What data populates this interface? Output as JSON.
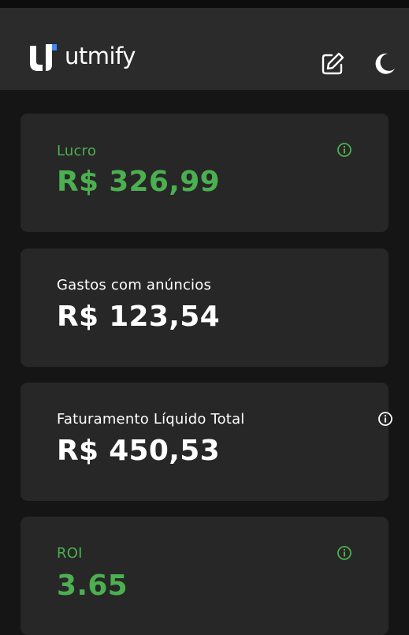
{
  "app": {
    "brand_name": "utmify",
    "colors": {
      "accent_green": "#4caf50",
      "header_bg": "#2b2b2b",
      "card_bg": "#272727",
      "page_bg": "#151515"
    },
    "icons": [
      "logo-mark-icon",
      "edit-icon",
      "moon-icon",
      "info-icon"
    ]
  },
  "cards": [
    {
      "label": "Lucro",
      "value": "R$ 326,99",
      "accent": "green"
    },
    {
      "label": "Gastos com anúncios",
      "value": "R$ 123,54",
      "accent": "white"
    },
    {
      "label": "Faturamento Líquido Total",
      "value": "R$ 450,53",
      "accent": "white"
    },
    {
      "label": "ROI",
      "value": "3.65",
      "accent": "green"
    }
  ]
}
